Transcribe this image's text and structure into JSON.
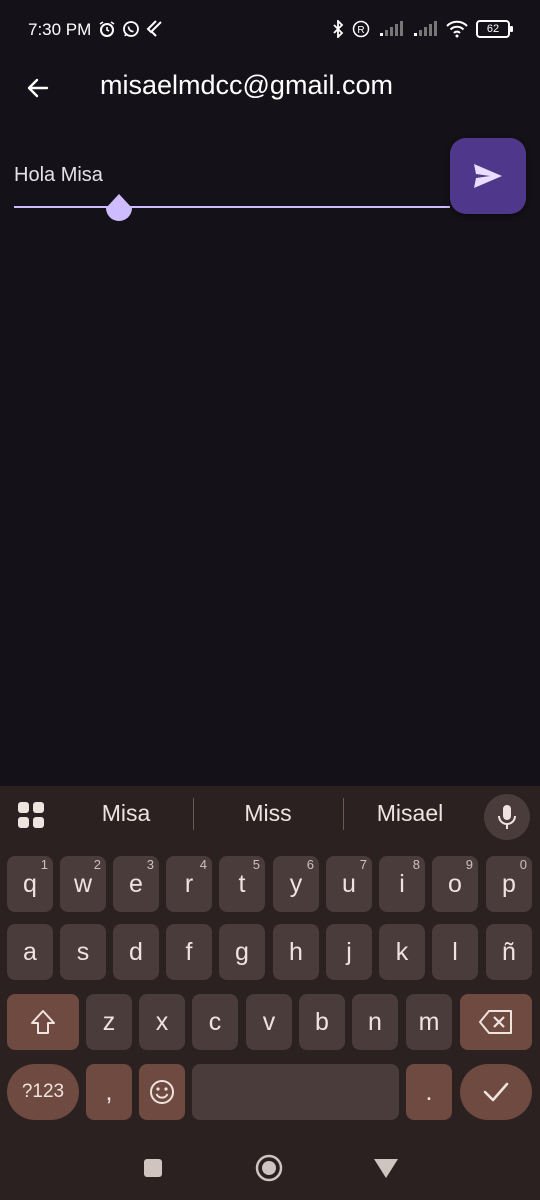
{
  "status_bar": {
    "time": "7:30 PM",
    "battery": "62",
    "left_icons": [
      "alarm-icon",
      "whatsapp-icon",
      "flutter-icon"
    ],
    "right_icons": [
      "bluetooth-icon",
      "roaming-icon",
      "signal-icon",
      "signal-icon",
      "wifi-icon",
      "battery-icon"
    ]
  },
  "app_bar": {
    "back_icon": "arrow-back-icon",
    "title": "misaelmdcc@gmail.com"
  },
  "message": {
    "text": "Hola Misa",
    "send_icon": "send-icon"
  },
  "colors": {
    "background": "#141218",
    "accent": "#cfbcff",
    "send_button": "#4f378b",
    "keyboard_bg": "#2b2120"
  },
  "keyboard": {
    "suggestions": [
      "Misa",
      "Miss",
      "Misael"
    ],
    "row1": [
      {
        "label": "q",
        "hint": "1"
      },
      {
        "label": "w",
        "hint": "2"
      },
      {
        "label": "e",
        "hint": "3"
      },
      {
        "label": "r",
        "hint": "4"
      },
      {
        "label": "t",
        "hint": "5"
      },
      {
        "label": "y",
        "hint": "6"
      },
      {
        "label": "u",
        "hint": "7"
      },
      {
        "label": "i",
        "hint": "8"
      },
      {
        "label": "o",
        "hint": "9"
      },
      {
        "label": "p",
        "hint": "0"
      }
    ],
    "row2": [
      "a",
      "s",
      "d",
      "f",
      "g",
      "h",
      "j",
      "k",
      "l",
      "ñ"
    ],
    "row3": [
      "z",
      "x",
      "c",
      "v",
      "b",
      "n",
      "m"
    ],
    "symbols_label": "?123",
    "comma_label": ",",
    "period_label": ".",
    "emoji_icon": "emoji-icon",
    "shift_icon": "shift-icon",
    "backspace_icon": "backspace-icon",
    "enter_icon": "check-icon",
    "mic_icon": "mic-icon",
    "menu_icon": "grid-menu-icon"
  },
  "nav_bar": {
    "recents_icon": "square-icon",
    "home_icon": "circle-icon",
    "back_icon": "triangle-back-icon"
  }
}
